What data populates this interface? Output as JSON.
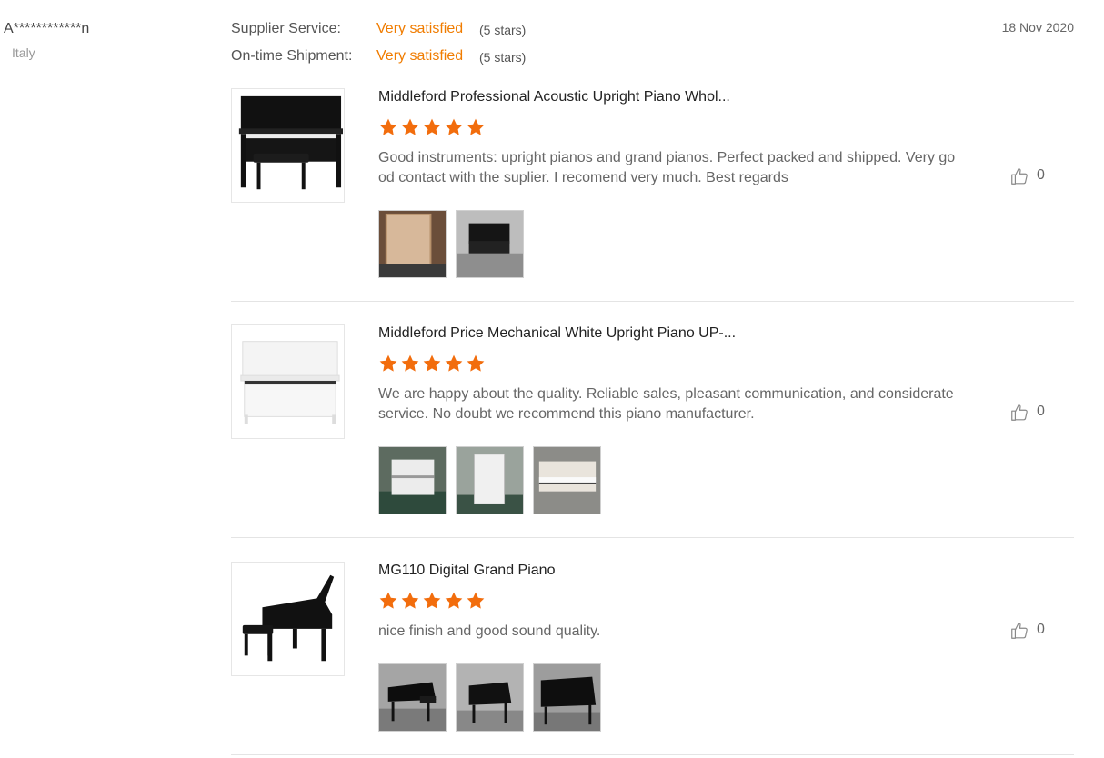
{
  "buyer": {
    "name": "A************n",
    "country": "Italy"
  },
  "date": "18 Nov 2020",
  "ratings": [
    {
      "label": "Supplier Service:",
      "value": "Very satisfied",
      "stars": "(5 stars)"
    },
    {
      "label": "On-time Shipment:",
      "value": "Very satisfied",
      "stars": "(5 stars)"
    }
  ],
  "colors": {
    "accent": "#f07c00",
    "star": "#f26d0d",
    "text_muted": "#666666"
  },
  "reviews": [
    {
      "product_title": "Middleford Professional Acoustic Upright Piano Whol...",
      "product_image": "black-upright-piano",
      "rating": 5,
      "text": "Good instruments: upright pianos and grand pianos. Perfect packed and shipped. Very good contact with the suplier. I recomend very much. Best regards",
      "likes": "0",
      "photos": [
        "wooden-crate-photo",
        "black-upright-piano-photo"
      ]
    },
    {
      "product_title": "Middleford Price Mechanical White Upright Piano UP-...",
      "product_image": "white-upright-piano",
      "rating": 5,
      "text": "We are happy about the quality. Reliable sales, pleasant communication, and considerate service. No doubt we recommend this piano manufacturer.",
      "likes": "0",
      "photos": [
        "white-piano-side-photo",
        "white-piano-front-photo",
        "white-piano-keys-photo"
      ]
    },
    {
      "product_title": "MG110 Digital Grand Piano",
      "product_image": "black-digital-grand-piano",
      "rating": 5,
      "text": "nice finish and good sound quality.",
      "likes": "0",
      "photos": [
        "grand-piano-side-photo",
        "grand-piano-rear-photo",
        "grand-piano-top-photo"
      ]
    }
  ]
}
